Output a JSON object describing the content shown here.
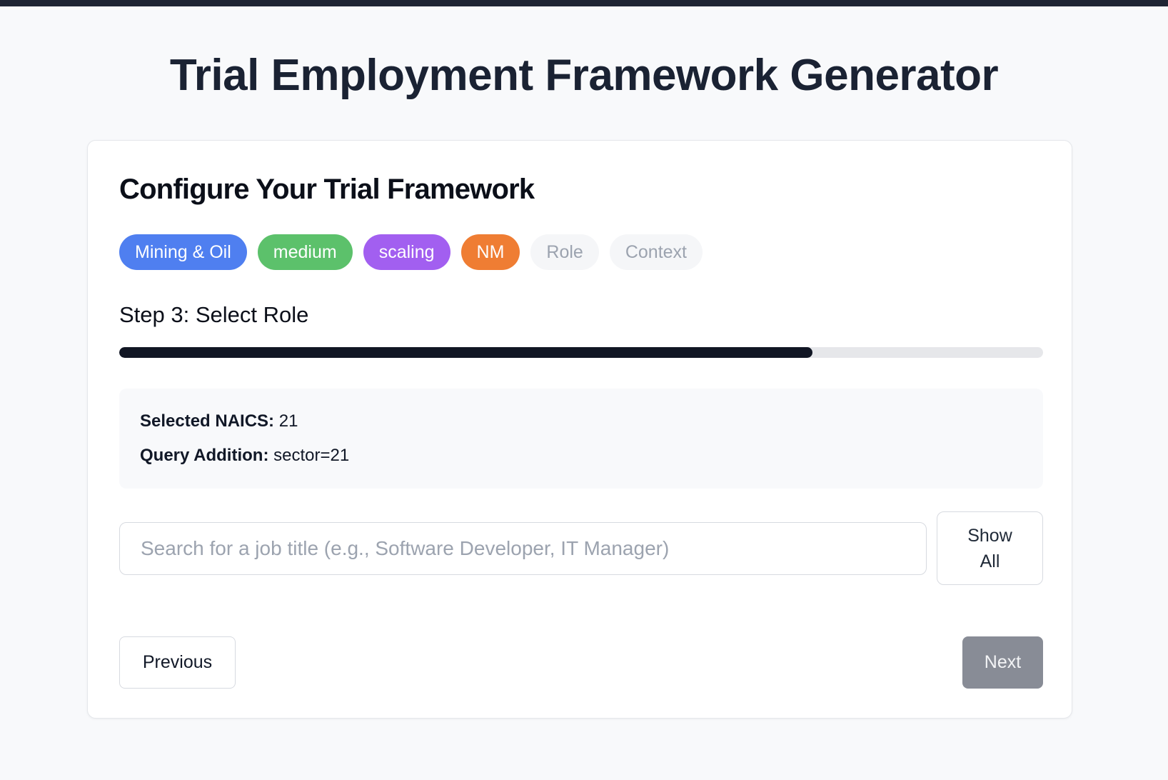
{
  "page": {
    "title": "Trial Employment Framework Generator"
  },
  "card": {
    "title": "Configure Your Trial Framework",
    "chips": [
      {
        "label": "Mining & Oil",
        "color": "#4f7ff0",
        "state": "completed"
      },
      {
        "label": "medium",
        "color": "#5cc16b",
        "state": "completed"
      },
      {
        "label": "scaling",
        "color": "#a25ff0",
        "state": "completed"
      },
      {
        "label": "NM",
        "color": "#ef7d33",
        "state": "completed"
      },
      {
        "label": "Role",
        "color": "#f5f6f8",
        "state": "pending"
      },
      {
        "label": "Context",
        "color": "#f5f6f8",
        "state": "pending"
      }
    ],
    "step": {
      "title": "Step 3: Select Role",
      "progress_percent": 75
    },
    "info": {
      "naics_label": "Selected NAICS:",
      "naics_value": "21",
      "query_label": "Query Addition:",
      "query_value": "sector=21"
    },
    "search": {
      "placeholder": "Search for a job title (e.g., Software Developer, IT Manager)",
      "value": ""
    },
    "show_all_label": "Show All",
    "previous_label": "Previous",
    "next_label": "Next"
  },
  "colors": {
    "topbar": "#1e2433",
    "progress_fill": "#111624",
    "next_disabled": "#888c96"
  }
}
